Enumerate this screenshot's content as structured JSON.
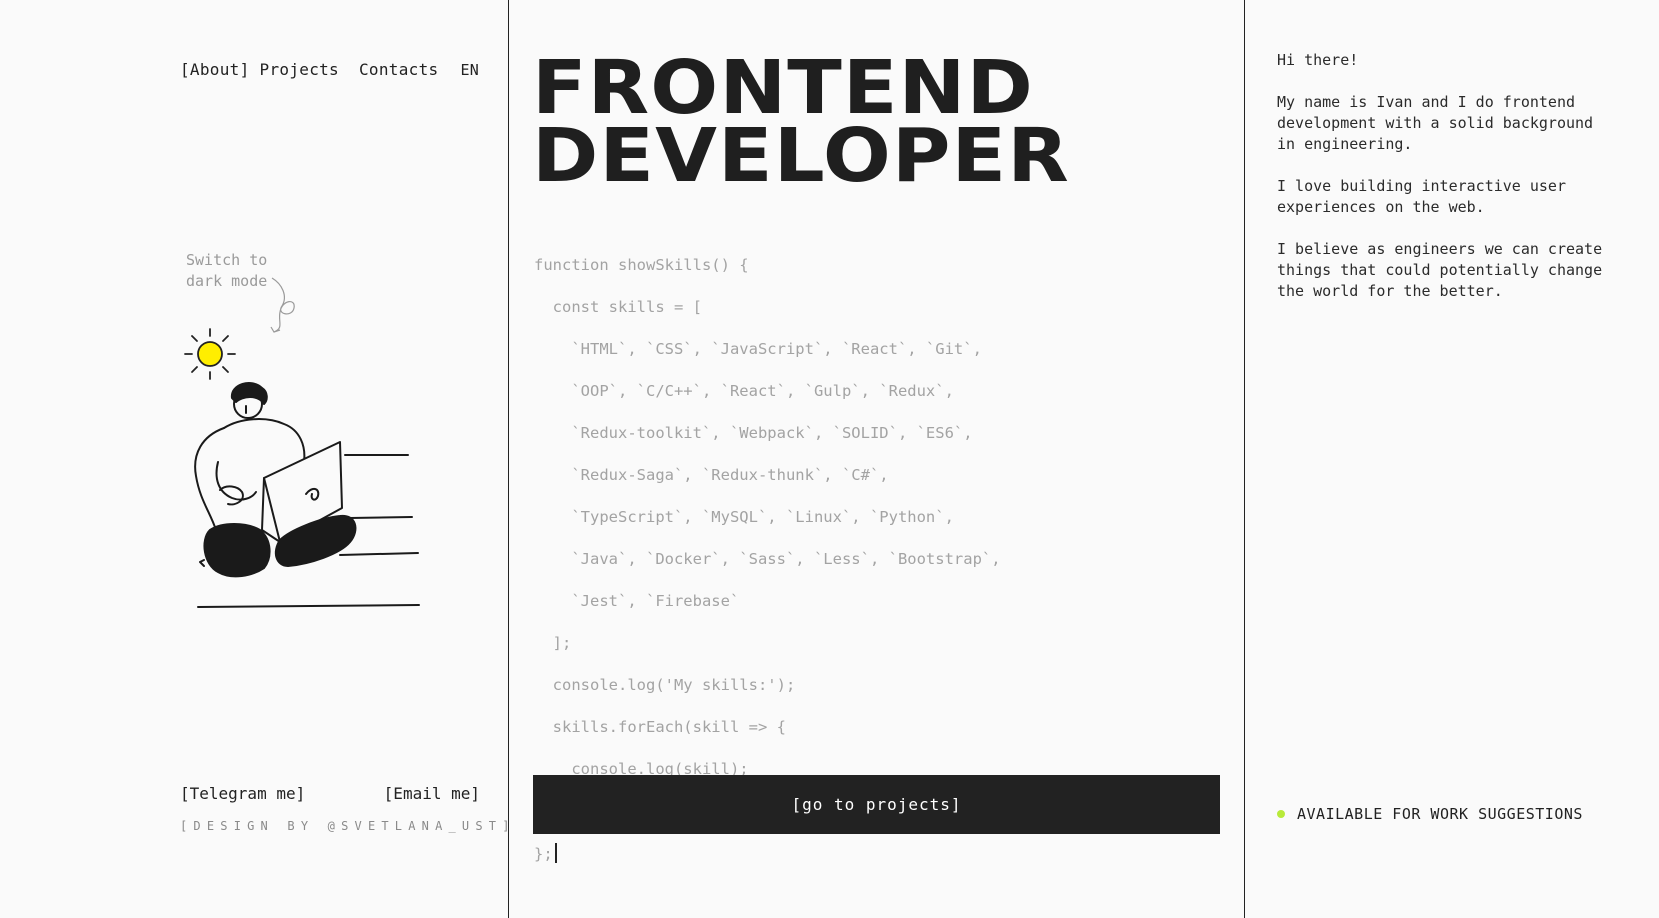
{
  "nav": {
    "about": "[About]",
    "projects": "Projects",
    "contacts": "Contacts",
    "language": "EN"
  },
  "theme_toggle": {
    "label": "Switch to dark mode",
    "icon": "sun-icon",
    "sun_color": "#ffee00"
  },
  "illustration": {
    "icon": "developer-with-laptop-illustration"
  },
  "contacts": {
    "telegram": "[Telegram me]",
    "email": "[Email me]",
    "credit": "[DESIGN BY @SVETLANA_UST]"
  },
  "hero": {
    "title_line1": "FRONTEND",
    "title_line2": "DEVELOPER"
  },
  "code": {
    "lines": [
      "function showSkills() {",
      "  const skills = [",
      "    `HTML`, `CSS`, `JavaScript`, `React`, `Git`,",
      "    `OOP`, `C/C++`, `React`, `Gulp`, `Redux`,",
      "    `Redux-toolkit`, `Webpack`, `SOLID`, `ES6`,",
      "    `Redux-Saga`, `Redux-thunk`, `C#`,",
      "    `TypeScript`, `MySQL`, `Linux`, `Python`,",
      "    `Java`, `Docker`, `Sass`, `Less`, `Bootstrap`,",
      "    `Jest`, `Firebase`",
      "  ];",
      "  console.log('My skills:');",
      "  skills.forEach(skill => {",
      "    console.log(skill);",
      "  });",
      "};"
    ]
  },
  "cta": {
    "label": "[go to projects]"
  },
  "bio": {
    "greeting": "Hi there!",
    "p1": "My name is Ivan and I do frontend development with a solid background in engineering.",
    "p2": "I love building interactive user experiences on the web.",
    "p3": "I believe as engineers we can create things that could potentially change the world for the better."
  },
  "status": {
    "label": "AVAILABLE FOR WORK SUGGESTIONS",
    "dot_color": "#b8ea3a"
  },
  "colors": {
    "background": "#fafafa",
    "text": "#222222",
    "code_text": "#a3a3a3",
    "button_bg": "#222222"
  }
}
